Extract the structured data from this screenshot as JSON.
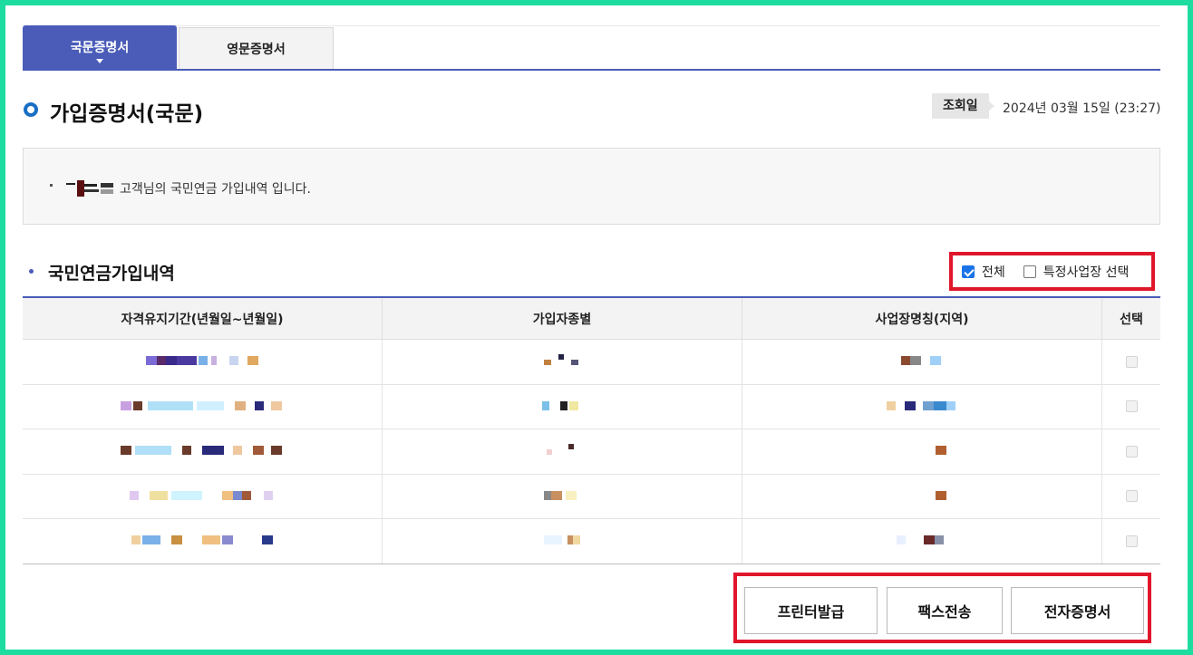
{
  "tabs": {
    "korean": "국문증명서",
    "english": "영문증명서"
  },
  "header": {
    "title": "가입증명서(국문)",
    "inquiry_label": "조회일",
    "inquiry_date": "2024년 03월 15일 (23:27)"
  },
  "info": {
    "message": "고객님의 국민연금 가입내역 입니다."
  },
  "section": {
    "title": "국민연금가입내역",
    "filter_all": "전체",
    "filter_specific": "특정사업장 선택",
    "filter_all_checked": true,
    "filter_specific_checked": false
  },
  "table": {
    "headers": [
      "자격유지기간(년월일~년월일)",
      "가입자종별",
      "사업장명칭(지역)",
      "선택"
    ],
    "row_count": 5
  },
  "actions": {
    "print": "프린터발급",
    "fax": "팩스전송",
    "electronic": "전자증명서"
  },
  "colors": {
    "accent": "#4a5cb8",
    "highlight": "#e0162b",
    "frame": "#1ddc9f"
  }
}
